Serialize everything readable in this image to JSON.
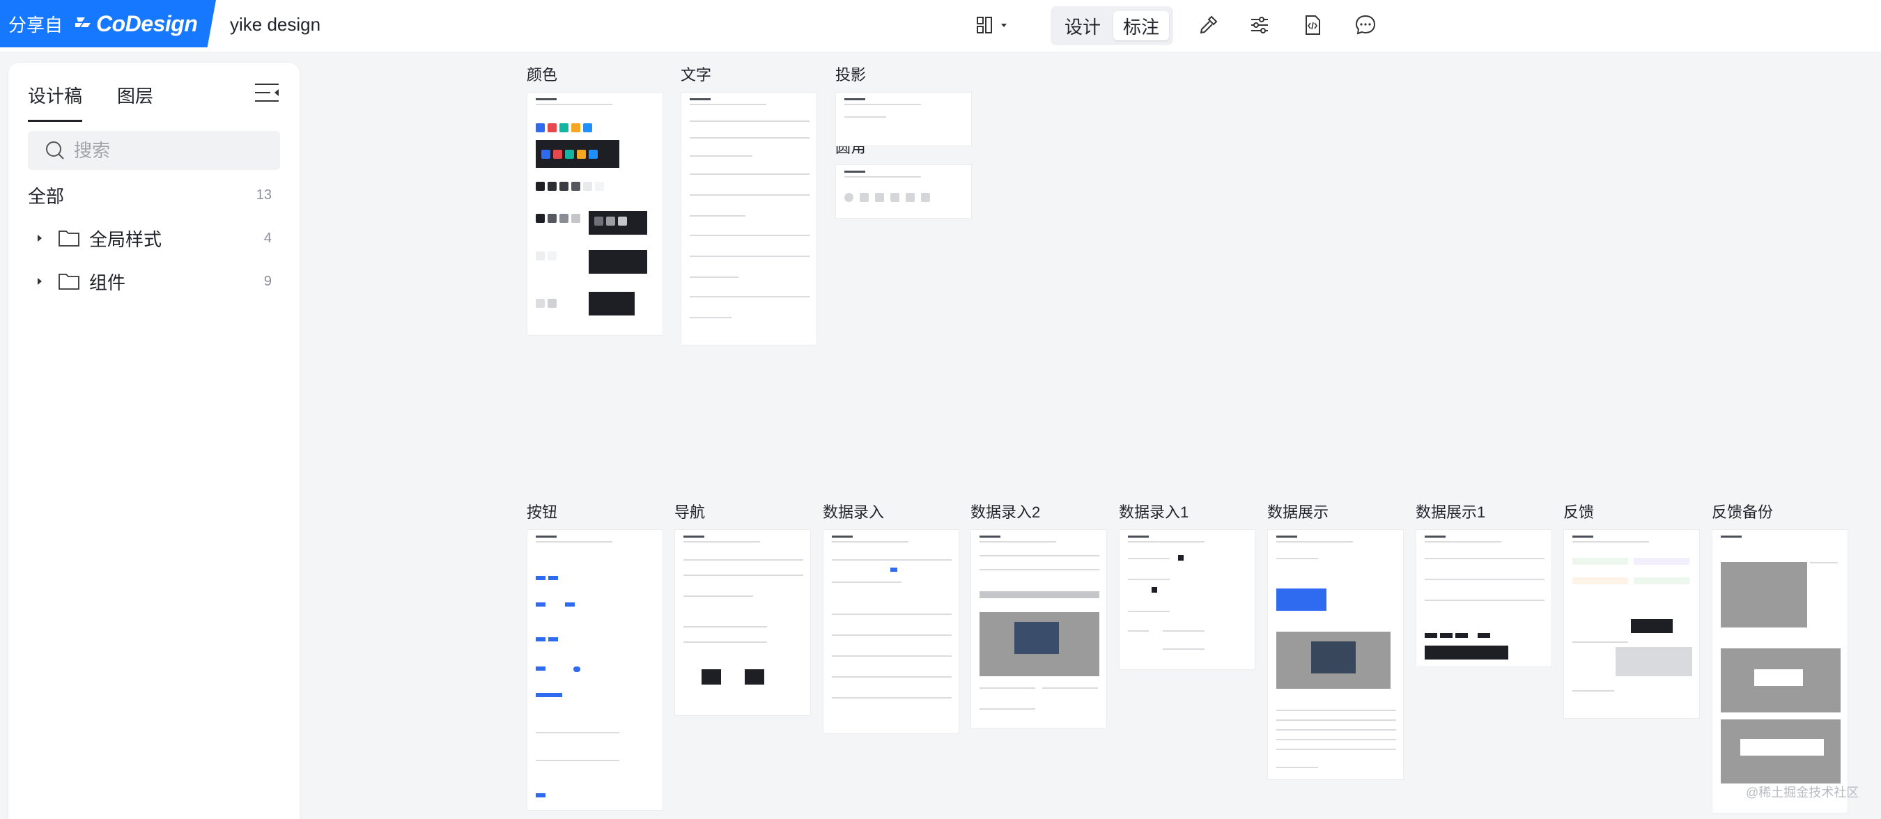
{
  "brand": {
    "share_label": "分享自",
    "product": "CoDesign",
    "color": "#1677ff"
  },
  "project": {
    "name": "yike design"
  },
  "toolbar": {
    "layout_icon": "grid-layout-icon",
    "mode_design": "设计",
    "mode_annotate": "标注",
    "tools": [
      "eyedropper-icon",
      "sliders-icon",
      "code-file-icon",
      "comment-icon"
    ]
  },
  "sidebar": {
    "tabs": [
      {
        "label": "设计稿",
        "active": true
      },
      {
        "label": "图层",
        "active": false
      }
    ],
    "search_placeholder": "搜索",
    "all": {
      "label": "全部",
      "count": "13"
    },
    "folders": [
      {
        "label": "全局样式",
        "count": "4"
      },
      {
        "label": "组件",
        "count": "9"
      }
    ]
  },
  "canvas": {
    "frames": [
      {
        "title": "颜色"
      },
      {
        "title": "文字"
      },
      {
        "title": "投影"
      },
      {
        "title": "圆角"
      },
      {
        "title": "按钮"
      },
      {
        "title": "导航"
      },
      {
        "title": "数据录入"
      },
      {
        "title": "数据录入2"
      },
      {
        "title": "数据录入1"
      },
      {
        "title": "数据展示"
      },
      {
        "title": "数据展示1"
      },
      {
        "title": "反馈"
      },
      {
        "title": "反馈备份"
      }
    ]
  },
  "watermark": "@稀土掘金技术社区",
  "colors": {
    "accent": "#1677ff",
    "swatches": [
      "#2f6bf0",
      "#e5484d",
      "#12b5a2",
      "#f5a623",
      "#1e90ff"
    ]
  }
}
